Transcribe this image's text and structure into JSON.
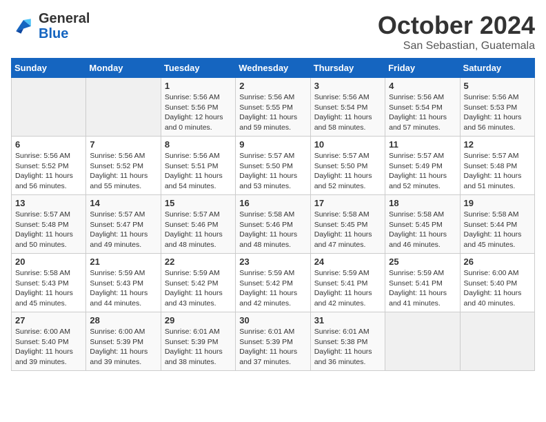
{
  "header": {
    "logo_general": "General",
    "logo_blue": "Blue",
    "month_title": "October 2024",
    "location": "San Sebastian, Guatemala"
  },
  "weekdays": [
    "Sunday",
    "Monday",
    "Tuesday",
    "Wednesday",
    "Thursday",
    "Friday",
    "Saturday"
  ],
  "weeks": [
    [
      {
        "day": "",
        "sunrise": "",
        "sunset": "",
        "daylight": ""
      },
      {
        "day": "",
        "sunrise": "",
        "sunset": "",
        "daylight": ""
      },
      {
        "day": "1",
        "sunrise": "Sunrise: 5:56 AM",
        "sunset": "Sunset: 5:56 PM",
        "daylight": "Daylight: 12 hours and 0 minutes."
      },
      {
        "day": "2",
        "sunrise": "Sunrise: 5:56 AM",
        "sunset": "Sunset: 5:55 PM",
        "daylight": "Daylight: 11 hours and 59 minutes."
      },
      {
        "day": "3",
        "sunrise": "Sunrise: 5:56 AM",
        "sunset": "Sunset: 5:54 PM",
        "daylight": "Daylight: 11 hours and 58 minutes."
      },
      {
        "day": "4",
        "sunrise": "Sunrise: 5:56 AM",
        "sunset": "Sunset: 5:54 PM",
        "daylight": "Daylight: 11 hours and 57 minutes."
      },
      {
        "day": "5",
        "sunrise": "Sunrise: 5:56 AM",
        "sunset": "Sunset: 5:53 PM",
        "daylight": "Daylight: 11 hours and 56 minutes."
      }
    ],
    [
      {
        "day": "6",
        "sunrise": "Sunrise: 5:56 AM",
        "sunset": "Sunset: 5:52 PM",
        "daylight": "Daylight: 11 hours and 56 minutes."
      },
      {
        "day": "7",
        "sunrise": "Sunrise: 5:56 AM",
        "sunset": "Sunset: 5:52 PM",
        "daylight": "Daylight: 11 hours and 55 minutes."
      },
      {
        "day": "8",
        "sunrise": "Sunrise: 5:56 AM",
        "sunset": "Sunset: 5:51 PM",
        "daylight": "Daylight: 11 hours and 54 minutes."
      },
      {
        "day": "9",
        "sunrise": "Sunrise: 5:57 AM",
        "sunset": "Sunset: 5:50 PM",
        "daylight": "Daylight: 11 hours and 53 minutes."
      },
      {
        "day": "10",
        "sunrise": "Sunrise: 5:57 AM",
        "sunset": "Sunset: 5:50 PM",
        "daylight": "Daylight: 11 hours and 52 minutes."
      },
      {
        "day": "11",
        "sunrise": "Sunrise: 5:57 AM",
        "sunset": "Sunset: 5:49 PM",
        "daylight": "Daylight: 11 hours and 52 minutes."
      },
      {
        "day": "12",
        "sunrise": "Sunrise: 5:57 AM",
        "sunset": "Sunset: 5:48 PM",
        "daylight": "Daylight: 11 hours and 51 minutes."
      }
    ],
    [
      {
        "day": "13",
        "sunrise": "Sunrise: 5:57 AM",
        "sunset": "Sunset: 5:48 PM",
        "daylight": "Daylight: 11 hours and 50 minutes."
      },
      {
        "day": "14",
        "sunrise": "Sunrise: 5:57 AM",
        "sunset": "Sunset: 5:47 PM",
        "daylight": "Daylight: 11 hours and 49 minutes."
      },
      {
        "day": "15",
        "sunrise": "Sunrise: 5:57 AM",
        "sunset": "Sunset: 5:46 PM",
        "daylight": "Daylight: 11 hours and 48 minutes."
      },
      {
        "day": "16",
        "sunrise": "Sunrise: 5:58 AM",
        "sunset": "Sunset: 5:46 PM",
        "daylight": "Daylight: 11 hours and 48 minutes."
      },
      {
        "day": "17",
        "sunrise": "Sunrise: 5:58 AM",
        "sunset": "Sunset: 5:45 PM",
        "daylight": "Daylight: 11 hours and 47 minutes."
      },
      {
        "day": "18",
        "sunrise": "Sunrise: 5:58 AM",
        "sunset": "Sunset: 5:45 PM",
        "daylight": "Daylight: 11 hours and 46 minutes."
      },
      {
        "day": "19",
        "sunrise": "Sunrise: 5:58 AM",
        "sunset": "Sunset: 5:44 PM",
        "daylight": "Daylight: 11 hours and 45 minutes."
      }
    ],
    [
      {
        "day": "20",
        "sunrise": "Sunrise: 5:58 AM",
        "sunset": "Sunset: 5:43 PM",
        "daylight": "Daylight: 11 hours and 45 minutes."
      },
      {
        "day": "21",
        "sunrise": "Sunrise: 5:59 AM",
        "sunset": "Sunset: 5:43 PM",
        "daylight": "Daylight: 11 hours and 44 minutes."
      },
      {
        "day": "22",
        "sunrise": "Sunrise: 5:59 AM",
        "sunset": "Sunset: 5:42 PM",
        "daylight": "Daylight: 11 hours and 43 minutes."
      },
      {
        "day": "23",
        "sunrise": "Sunrise: 5:59 AM",
        "sunset": "Sunset: 5:42 PM",
        "daylight": "Daylight: 11 hours and 42 minutes."
      },
      {
        "day": "24",
        "sunrise": "Sunrise: 5:59 AM",
        "sunset": "Sunset: 5:41 PM",
        "daylight": "Daylight: 11 hours and 42 minutes."
      },
      {
        "day": "25",
        "sunrise": "Sunrise: 5:59 AM",
        "sunset": "Sunset: 5:41 PM",
        "daylight": "Daylight: 11 hours and 41 minutes."
      },
      {
        "day": "26",
        "sunrise": "Sunrise: 6:00 AM",
        "sunset": "Sunset: 5:40 PM",
        "daylight": "Daylight: 11 hours and 40 minutes."
      }
    ],
    [
      {
        "day": "27",
        "sunrise": "Sunrise: 6:00 AM",
        "sunset": "Sunset: 5:40 PM",
        "daylight": "Daylight: 11 hours and 39 minutes."
      },
      {
        "day": "28",
        "sunrise": "Sunrise: 6:00 AM",
        "sunset": "Sunset: 5:39 PM",
        "daylight": "Daylight: 11 hours and 39 minutes."
      },
      {
        "day": "29",
        "sunrise": "Sunrise: 6:01 AM",
        "sunset": "Sunset: 5:39 PM",
        "daylight": "Daylight: 11 hours and 38 minutes."
      },
      {
        "day": "30",
        "sunrise": "Sunrise: 6:01 AM",
        "sunset": "Sunset: 5:39 PM",
        "daylight": "Daylight: 11 hours and 37 minutes."
      },
      {
        "day": "31",
        "sunrise": "Sunrise: 6:01 AM",
        "sunset": "Sunset: 5:38 PM",
        "daylight": "Daylight: 11 hours and 36 minutes."
      },
      {
        "day": "",
        "sunrise": "",
        "sunset": "",
        "daylight": ""
      },
      {
        "day": "",
        "sunrise": "",
        "sunset": "",
        "daylight": ""
      }
    ]
  ]
}
